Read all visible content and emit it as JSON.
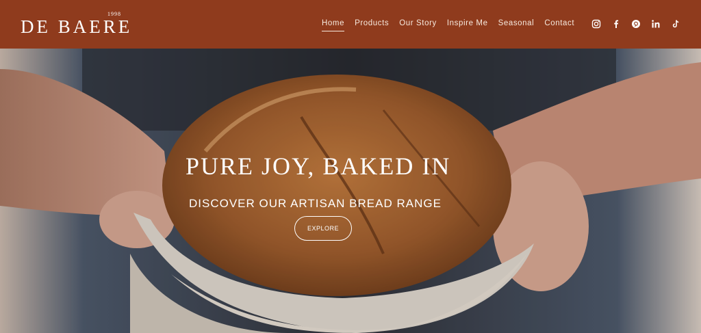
{
  "brand": {
    "name": "DE BAERE",
    "year": "1998"
  },
  "nav": {
    "items": [
      {
        "label": "Home",
        "active": true
      },
      {
        "label": "Products"
      },
      {
        "label": "Our Story"
      },
      {
        "label": "Inspire Me"
      },
      {
        "label": "Seasonal"
      },
      {
        "label": "Contact"
      }
    ]
  },
  "social": [
    "instagram-icon",
    "facebook-icon",
    "pinterest-icon",
    "linkedin-icon",
    "tiktok-icon"
  ],
  "hero": {
    "title": "PURE JOY, BAKED IN",
    "subtitle": "DISCOVER OUR ARTISAN BREAD RANGE",
    "cta_label": "EXPLORE"
  },
  "colors": {
    "header_bg": "#8f3b1d",
    "text": "#ffffff"
  }
}
